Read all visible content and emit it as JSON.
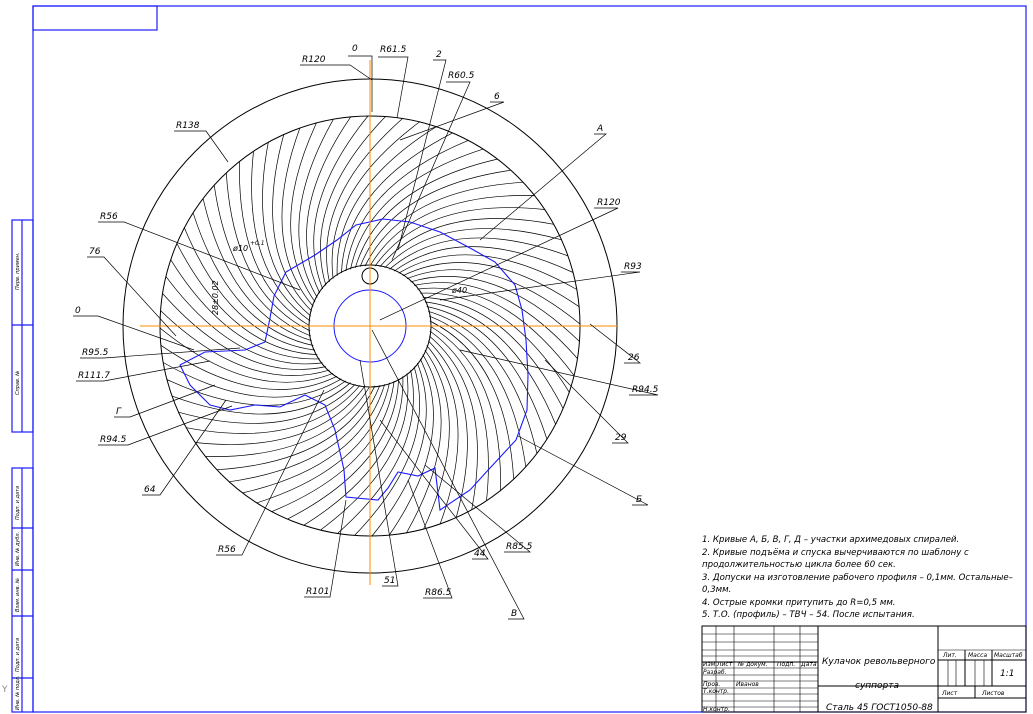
{
  "colors": {
    "frame": "#1a1aff",
    "ink": "#000000",
    "contour": "#1a1aff",
    "axis": "#ff8c00"
  },
  "labels": {
    "l_0top": "0",
    "l_r615": "R61.5",
    "l_2": "2",
    "l_r120a": "R120",
    "l_r605": "R60.5",
    "l_6": "6",
    "l_r138": "R138",
    "l_A": "A",
    "l_r120b": "R120",
    "l_r56a": "R56",
    "l_76": "76",
    "l_r93": "R93",
    "l_0left": "0",
    "l_r955": "R95.5",
    "l_r1117": "R111.7",
    "l_26": "26",
    "l_G": "Г",
    "l_r945a": "R94.5",
    "l_29": "29",
    "l_r945b": "R94.5",
    "l_64": "64",
    "l_B6": "Б",
    "l_r56b": "R56",
    "l_44": "44",
    "l_r855": "R85.5",
    "l_r101": "R101",
    "l_51": "51",
    "l_r865": "R86.5",
    "l_V": "В",
    "l_d10": "ø10",
    "l_d10tol": "+0.1",
    "l_d40": "ø40",
    "l_dim": "28±0.02"
  },
  "notes": [
    "1. Кривые А, Б, В, Г, Д – участки архимедовых спиралей.",
    "2. Кривые подъёма и спуска вычерчиваются по шаблону с",
    "продолжительностью цикла более 60 сек.",
    "3. Допуски на изготовление рабочего профиля – 0,1мм. Остальные–",
    "0,3мм.",
    "4. Острые кромки притупить до R=0,5 мм.",
    "5. Т.О. (профиль) – ТВЧ – 54. После испытания."
  ],
  "title_block": {
    "h_izm": "Изм.",
    "h_list": "Лист",
    "h_doc": "№ докум.",
    "h_sign": "Подп.",
    "h_date": "Дата",
    "r_razrab": "Разраб.",
    "r_prov": "Пров.",
    "r_prov_name": "Иванов",
    "r_tkontr": "Т.контр.",
    "r_nkontr": "Н.контр.",
    "name_line1": "Кулачок револьверного",
    "name_line2": "суппорта",
    "material": "Сталь 45 ГОСТ1050-88",
    "col_lit": "Лит.",
    "col_mass": "Масса",
    "col_scale": "Масштаб",
    "scale_value": "1:1",
    "col_sheet": "Лист",
    "col_sheets": "Листов"
  },
  "side_stamp": [
    "Перв. примен.",
    "Справ. №",
    "Подп. и дата",
    "Инв. № дубл.",
    "Взам. инв. №",
    "Подп. и дата",
    "Инв. № подл."
  ],
  "corner_mark": "Y"
}
